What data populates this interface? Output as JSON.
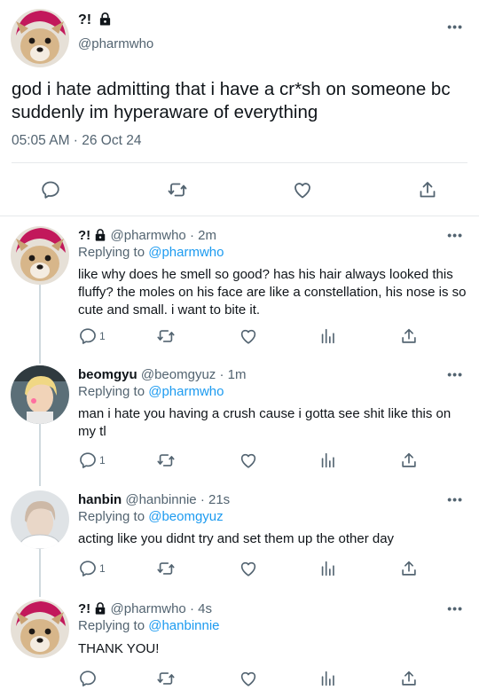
{
  "main_tweet": {
    "name": "?!",
    "handle": "@pharmwho",
    "text": "god i hate admitting that i have a cr*sh on someone bc suddenly im hyperaware of everything",
    "time": "05:05 AM · 26 Oct 24",
    "more": "•••",
    "actions": [
      "reply-icon",
      "retweet-icon",
      "like-icon",
      "share-icon"
    ]
  },
  "replies": [
    {
      "name": "?!",
      "locked": true,
      "handle": "@pharmwho",
      "age": "· 2m",
      "replying_label": "Replying to",
      "replying_to": "@pharmwho",
      "text": "like why does he smell so good? has his hair always looked this fluffy? the moles on his face are like a constellation, his nose is so cute and small. i want to bite it.",
      "reply_count": "1",
      "more": "•••"
    },
    {
      "name": "beomgyu",
      "locked": false,
      "handle": "@beomgyuz",
      "age": "· 1m",
      "replying_label": "Replying to",
      "replying_to": "@pharmwho",
      "text": "man i hate you having a crush cause i gotta see shit like this on my tl",
      "reply_count": "1",
      "more": "•••"
    },
    {
      "name": "hanbin",
      "locked": false,
      "handle": "@hanbinnie",
      "age": "· 21s",
      "replying_label": "Replying to",
      "replying_to": "@beomgyuz",
      "text": "acting like you didnt try and set them up the other day",
      "reply_count": "1",
      "more": "•••"
    },
    {
      "name": "?!",
      "locked": true,
      "handle": "@pharmwho",
      "age": "· 4s",
      "replying_label": "Replying to",
      "replying_to": "@hanbinnie",
      "text": "THANK YOU!",
      "reply_count": "",
      "more": "•••"
    }
  ],
  "colors": {
    "link": "#1d9bf0",
    "muted": "#536471",
    "divider": "#e6e9eb",
    "avatar_hat": "#c2185b"
  }
}
